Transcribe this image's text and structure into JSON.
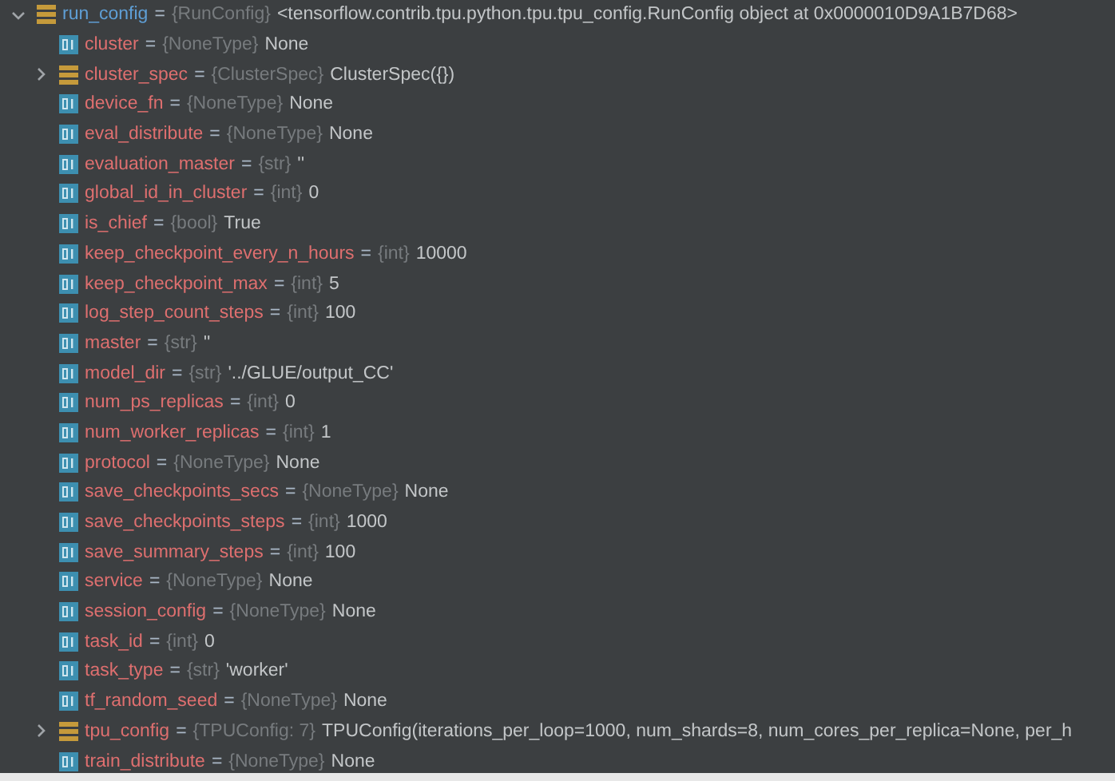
{
  "tree": {
    "name": "run_config",
    "equals": "=",
    "type": "{RunConfig}",
    "value": "<tensorflow.contrib.tpu.python.tpu.tpu_config.RunConfig object at 0x0000010D9A1B7D68>",
    "kind": "object",
    "expanded": true,
    "children": [
      {
        "name": "cluster",
        "equals": "=",
        "type": "{NoneType}",
        "value": "None",
        "kind": "primitive"
      },
      {
        "name": "cluster_spec",
        "equals": "=",
        "type": "{ClusterSpec}",
        "value": "ClusterSpec({})",
        "kind": "object",
        "expanded": false
      },
      {
        "name": "device_fn",
        "equals": "=",
        "type": "{NoneType}",
        "value": "None",
        "kind": "primitive"
      },
      {
        "name": "eval_distribute",
        "equals": "=",
        "type": "{NoneType}",
        "value": "None",
        "kind": "primitive"
      },
      {
        "name": "evaluation_master",
        "equals": "=",
        "type": "{str}",
        "value": "''",
        "kind": "primitive"
      },
      {
        "name": "global_id_in_cluster",
        "equals": "=",
        "type": "{int}",
        "value": "0",
        "kind": "primitive"
      },
      {
        "name": "is_chief",
        "equals": "=",
        "type": "{bool}",
        "value": "True",
        "kind": "primitive"
      },
      {
        "name": "keep_checkpoint_every_n_hours",
        "equals": "=",
        "type": "{int}",
        "value": "10000",
        "kind": "primitive"
      },
      {
        "name": "keep_checkpoint_max",
        "equals": "=",
        "type": "{int}",
        "value": "5",
        "kind": "primitive"
      },
      {
        "name": "log_step_count_steps",
        "equals": "=",
        "type": "{int}",
        "value": "100",
        "kind": "primitive"
      },
      {
        "name": "master",
        "equals": "=",
        "type": "{str}",
        "value": "''",
        "kind": "primitive"
      },
      {
        "name": "model_dir",
        "equals": "=",
        "type": "{str}",
        "value": "'../GLUE/output_CC'",
        "kind": "primitive"
      },
      {
        "name": "num_ps_replicas",
        "equals": "=",
        "type": "{int}",
        "value": "0",
        "kind": "primitive"
      },
      {
        "name": "num_worker_replicas",
        "equals": "=",
        "type": "{int}",
        "value": "1",
        "kind": "primitive"
      },
      {
        "name": "protocol",
        "equals": "=",
        "type": "{NoneType}",
        "value": "None",
        "kind": "primitive"
      },
      {
        "name": "save_checkpoints_secs",
        "equals": "=",
        "type": "{NoneType}",
        "value": "None",
        "kind": "primitive"
      },
      {
        "name": "save_checkpoints_steps",
        "equals": "=",
        "type": "{int}",
        "value": "1000",
        "kind": "primitive"
      },
      {
        "name": "save_summary_steps",
        "equals": "=",
        "type": "{int}",
        "value": "100",
        "kind": "primitive"
      },
      {
        "name": "service",
        "equals": "=",
        "type": "{NoneType}",
        "value": "None",
        "kind": "primitive"
      },
      {
        "name": "session_config",
        "equals": "=",
        "type": "{NoneType}",
        "value": "None",
        "kind": "primitive"
      },
      {
        "name": "task_id",
        "equals": "=",
        "type": "{int}",
        "value": "0",
        "kind": "primitive"
      },
      {
        "name": "task_type",
        "equals": "=",
        "type": "{str}",
        "value": "'worker'",
        "kind": "primitive"
      },
      {
        "name": "tf_random_seed",
        "equals": "=",
        "type": "{NoneType}",
        "value": "None",
        "kind": "primitive"
      },
      {
        "name": "tpu_config",
        "equals": "=",
        "type": "{TPUConfig: 7}",
        "value": "TPUConfig(iterations_per_loop=1000, num_shards=8, num_cores_per_replica=None, per_h",
        "kind": "object",
        "expanded": false
      },
      {
        "name": "train_distribute",
        "equals": "=",
        "type": "{NoneType}",
        "value": "None",
        "kind": "primitive"
      }
    ]
  }
}
